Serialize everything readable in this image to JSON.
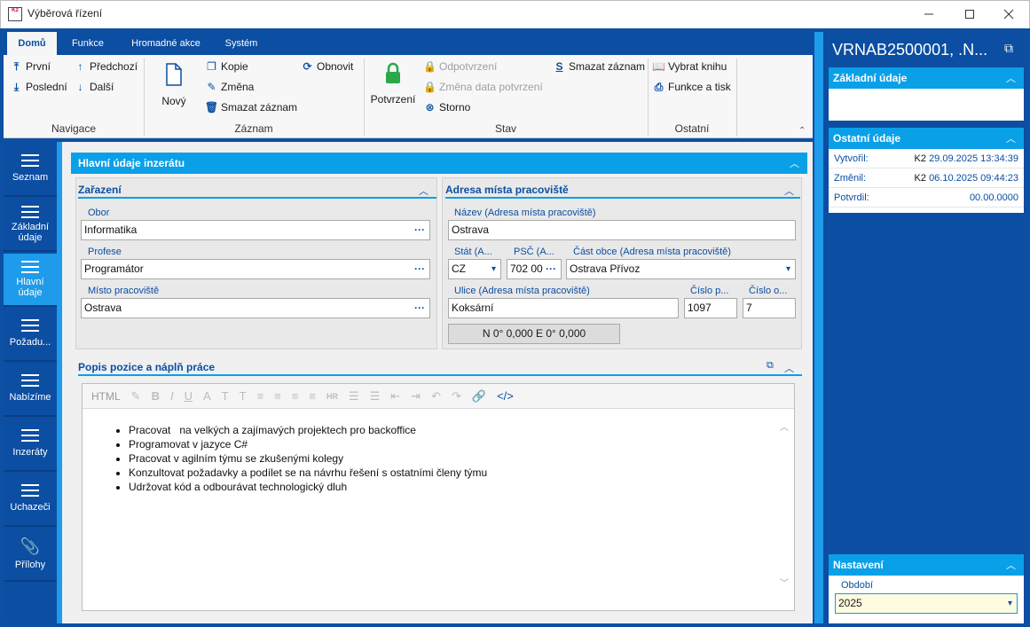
{
  "window": {
    "title": "Výběrová řízení",
    "logo_text": "K2"
  },
  "tabs": [
    {
      "label": "Domů"
    },
    {
      "label": "Funkce"
    },
    {
      "label": "Hromadné akce"
    },
    {
      "label": "Systém"
    }
  ],
  "ribbon": {
    "nav": {
      "first": "První",
      "prev": "Předchozí",
      "last": "Poslední",
      "next": "Další",
      "group": "Navigace"
    },
    "record": {
      "new": "Nový",
      "copy": "Kopie",
      "edit": "Změna",
      "delete": "Smazat záznam",
      "refresh": "Obnovit",
      "group": "Záznam"
    },
    "state": {
      "confirm": "Potvrzení",
      "unconfirm": "Odpotvrzení",
      "change_date": "Změna data potvrzení",
      "cancel": "Storno",
      "delete_rec": "Smazat záznam",
      "group": "Stav"
    },
    "other": {
      "pick_book": "Vybrat knihu",
      "func_print": "Funkce a tisk",
      "group": "Ostatní"
    }
  },
  "leftnav": [
    {
      "label": "Seznam"
    },
    {
      "label": "Základní údaje"
    },
    {
      "label": "Hlavní údaje"
    },
    {
      "label": "Požadu..."
    },
    {
      "label": "Nabízíme"
    },
    {
      "label": "Inzeráty"
    },
    {
      "label": "Uchazeči"
    },
    {
      "label": "Přílohy"
    }
  ],
  "main": {
    "section_title": "Hlavní údaje inzerátu",
    "zarazeni": {
      "title": "Zařazení",
      "obor_label": "Obor",
      "obor": "Informatika",
      "profese_label": "Profese",
      "profese": "Programátor",
      "misto_label": "Místo pracoviště",
      "misto": "Ostrava"
    },
    "adresa": {
      "title": "Adresa místa pracoviště",
      "nazev_label": "Název (Adresa místa pracoviště)",
      "nazev": "Ostrava",
      "stat_label": "Stát (A...",
      "stat": "CZ",
      "psc_label": "PSČ (A...",
      "psc": "702 00",
      "cast_label": "Část obce (Adresa místa pracoviště)",
      "cast": "Ostrava Přívoz",
      "ulice_label": "Ulice (Adresa místa pracoviště)",
      "ulice": "Koksární",
      "cislo_p_label": "Číslo p...",
      "cislo_p": "1097",
      "cislo_o_label": "Číslo o...",
      "cislo_o": "7",
      "gps": "N 0° 0,000 E 0° 0,000"
    },
    "popis": {
      "title": "Popis pozice a náplň práce",
      "format": "HTML",
      "items": [
        "Pracovat   na velkých a zajímavých projektech pro backoffice",
        "Programovat v jazyce C#",
        "Pracovat v agilním týmu se zkušenými kolegy",
        "Konzultovat požadavky a podílet se na návrhu řešení s ostatními členy týmu",
        "Udržovat kód a odbourávat technologický dluh"
      ]
    }
  },
  "right": {
    "title": "VRNAB2500001, .N...",
    "zakladni": "Základní údaje",
    "ostatni": "Ostatní údaje",
    "vytvoril_label": "Vytvořil:",
    "vytvoril_user": "K2",
    "vytvoril_date": "29.09.2025 13:34:39",
    "zmenil_label": "Změnil:",
    "zmenil_user": "K2",
    "zmenil_date": "06.10.2025 09:44:23",
    "potvrdil_label": "Potvrdil:",
    "potvrdil_date": "00.00.0000",
    "nastaveni": "Nastavení",
    "obdobi_label": "Období",
    "obdobi": "2025"
  },
  "colors": {
    "brand": "#0b4ea2",
    "accent": "#0aa0e8",
    "confirm_green": "#2aa84a"
  }
}
